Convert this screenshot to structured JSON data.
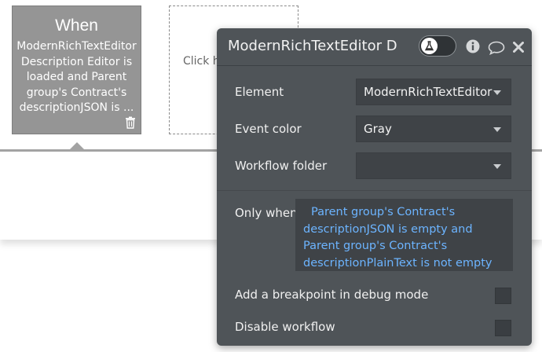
{
  "event_card": {
    "title": "When",
    "description": "ModernRichTextEditor Description Editor is loaded and Parent group's Contract's descriptionJSON is ..."
  },
  "add_action_card": {
    "text": "Click h..."
  },
  "panel": {
    "title": "ModernRichTextEditor D",
    "fields": {
      "element_label": "Element",
      "element_value": "ModernRichTextEditor ...",
      "event_color_label": "Event color",
      "event_color_value": "Gray",
      "workflow_folder_label": "Workflow folder",
      "workflow_folder_value": "",
      "only_when_label": "Only when",
      "only_when_expression": "Parent group's Contract's descriptionJSON is empty and Parent group's Contract's descriptionPlainText is not empty",
      "breakpoint_label": "Add a breakpoint in debug mode",
      "disable_label": "Disable workflow"
    },
    "icons": [
      "flask-icon",
      "info-icon",
      "comment-icon",
      "close-icon"
    ]
  },
  "colors": {
    "panel_bg": "#4f5458",
    "field_bg": "#3f4347",
    "expression_text": "#6cb4ff",
    "event_card_bg": "#959595"
  }
}
